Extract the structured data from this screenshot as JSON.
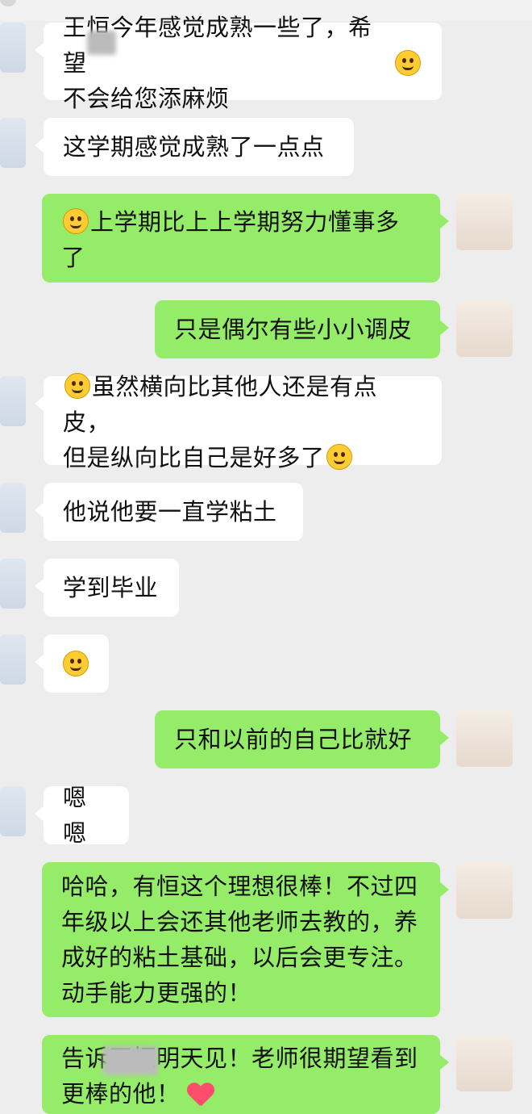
{
  "messages": [
    {
      "side": "in",
      "text": "王恒今年感觉成熟一些了，希望\n不会给您添麻烦",
      "emoji_end": "laugh-tears-emoji"
    },
    {
      "side": "in",
      "text": "这学期感觉成熟了一点点"
    },
    {
      "side": "out",
      "emoji_start": "smile-emoji",
      "text": "上学期比上上学期努力懂事多\n了"
    },
    {
      "side": "out",
      "text": "只是偶尔有些小小调皮"
    },
    {
      "side": "in",
      "emoji_start": "thinking-emoji",
      "text": "虽然横向比其他人还是有点皮，\n但是纵向比自己是好多了",
      "emoji_end": "grin-emoji"
    },
    {
      "side": "in",
      "text": "他说他要一直学粘土"
    },
    {
      "side": "in",
      "text": "学到毕业"
    },
    {
      "side": "in",
      "emoji_only": "laugh-emoji"
    },
    {
      "side": "out",
      "text": "只和以前的自己比就好"
    },
    {
      "side": "in",
      "text": "嗯嗯"
    },
    {
      "side": "out",
      "text": "哈哈，有恒这个理想很棒！不过四\n年级以上会还其他老师去教的，养\n成好的粘土基础，以后会更专注。\n动手能力更强的！"
    },
    {
      "side": "out",
      "text": "告诉王恒明天见！老师很期望看到\n更棒的他！",
      "emoji_end": "heart-emoji"
    }
  ]
}
